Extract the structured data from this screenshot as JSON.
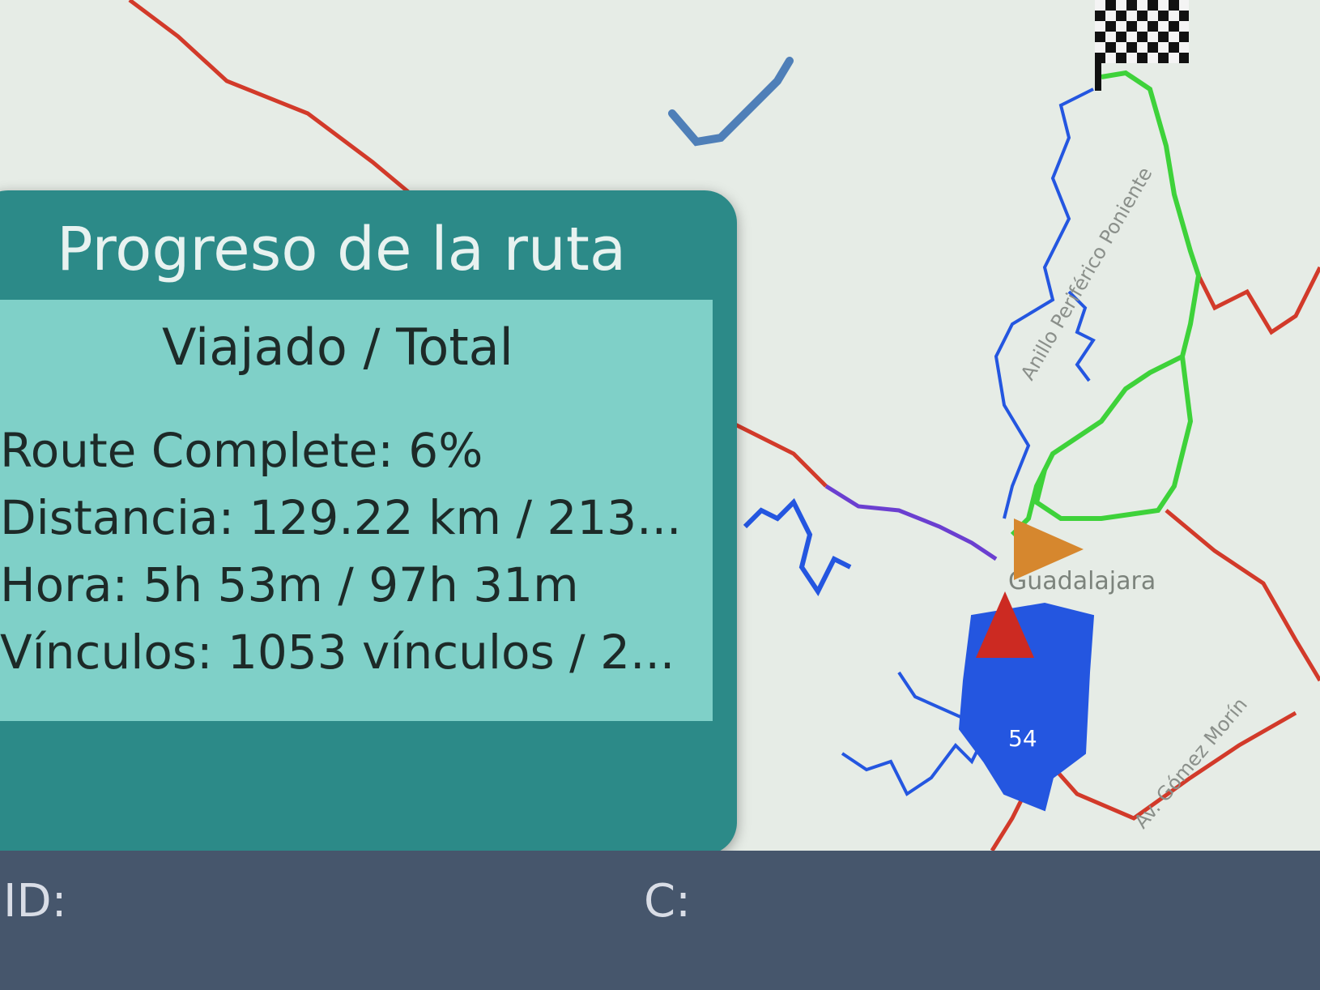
{
  "map": {
    "labels": {
      "city": "Guadalajara",
      "ring_road": "Anillo Periférico Poniente",
      "road_south": "Av. Gómez Morín",
      "route_number": "54"
    },
    "colors": {
      "road_red": "#d23a2a",
      "road_green": "#3ed23a",
      "water_blue": "#2456e0",
      "route_purple": "#6b3fd0",
      "position_arrow": "#d6872e",
      "direction_marker": "#cc2a22"
    },
    "icons": [
      "finish-flag-icon",
      "position-arrow-icon",
      "direction-marker-icon"
    ]
  },
  "route_progress": {
    "title": "Progreso de la ruta",
    "subtitle": "Viajado / Total",
    "route_complete": "Route Complete: 6%",
    "distance": "Distancia: 129.22 km / 213...",
    "time": "Hora: 5h 53m / 97h 31m",
    "links": "Vínculos: 1053 vínculos / 2...",
    "percent_complete": 6,
    "colors": {
      "header": "#2c8a88",
      "body": "#7fd0c8"
    }
  },
  "bottom_bar": {
    "id_label": "ID:",
    "c_label": "C:"
  }
}
